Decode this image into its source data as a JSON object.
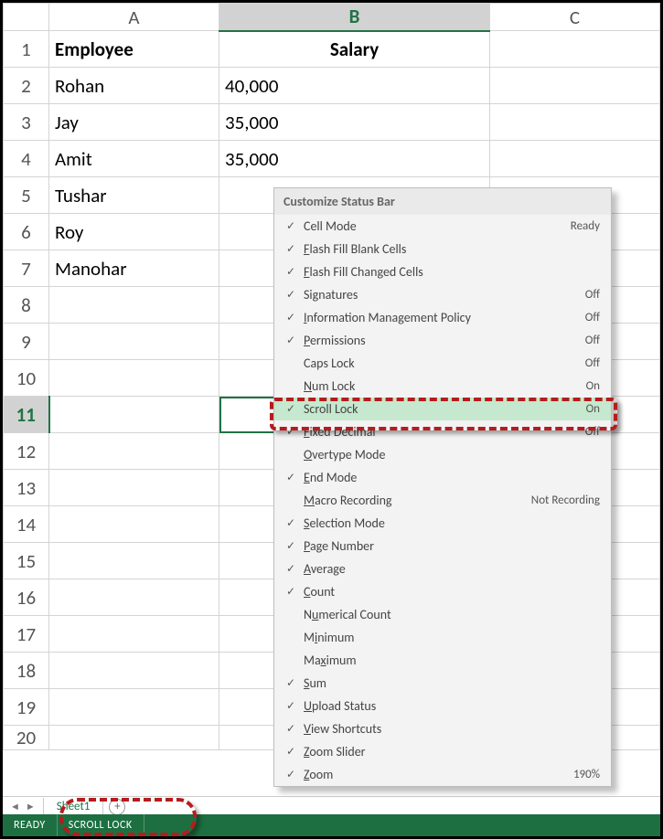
{
  "columns": [
    "A",
    "B",
    "C"
  ],
  "active_column": "B",
  "active_row": 11,
  "rows": [
    {
      "n": 1,
      "a": "Employee",
      "b": "Salary",
      "header": true
    },
    {
      "n": 2,
      "a": "Rohan",
      "b": "40,000"
    },
    {
      "n": 3,
      "a": "Jay",
      "b": "35,000"
    },
    {
      "n": 4,
      "a": "Amit",
      "b": "35,000"
    },
    {
      "n": 5,
      "a": "Tushar",
      "b": ""
    },
    {
      "n": 6,
      "a": "Roy",
      "b": ""
    },
    {
      "n": 7,
      "a": "Manohar",
      "b": ""
    },
    {
      "n": 8,
      "a": "",
      "b": ""
    },
    {
      "n": 9,
      "a": "",
      "b": ""
    },
    {
      "n": 10,
      "a": "",
      "b": ""
    },
    {
      "n": 11,
      "a": "",
      "b": "",
      "sel": true
    },
    {
      "n": 12,
      "a": "",
      "b": ""
    },
    {
      "n": 13,
      "a": "",
      "b": ""
    },
    {
      "n": 14,
      "a": "",
      "b": ""
    },
    {
      "n": 15,
      "a": "",
      "b": ""
    },
    {
      "n": 16,
      "a": "",
      "b": ""
    },
    {
      "n": 17,
      "a": "",
      "b": ""
    },
    {
      "n": 18,
      "a": "",
      "b": ""
    },
    {
      "n": 19,
      "a": "",
      "b": ""
    },
    {
      "n": 20,
      "a": "",
      "b": ""
    }
  ],
  "sheet_tab": "Sheet1",
  "newtab_glyph": "+",
  "status": {
    "ready": "READY",
    "scroll_lock": "SCROLL LOCK"
  },
  "menu": {
    "title": "Customize Status Bar",
    "items": [
      {
        "check": true,
        "label": "Cell Mode",
        "ul": "",
        "val": "Ready"
      },
      {
        "check": true,
        "label": "Flash Fill Blank Cells",
        "ul": "F"
      },
      {
        "check": true,
        "label": "Flash Fill Changed Cells",
        "ul": "F"
      },
      {
        "check": true,
        "label": "Signatures",
        "val": "Off"
      },
      {
        "check": true,
        "label": "Information Management Policy",
        "ul": "I",
        "val": "Off"
      },
      {
        "check": true,
        "label": "Permissions",
        "ul": "P",
        "val": "Off"
      },
      {
        "check": false,
        "label": "Caps Lock",
        "val": "Off"
      },
      {
        "check": false,
        "label": "Num Lock",
        "ul": "N",
        "val": "On"
      },
      {
        "check": true,
        "label": "Scroll Lock",
        "ul": "",
        "val": "On",
        "highlight": true
      },
      {
        "check": true,
        "label": "Fixed Decimal",
        "ul": "F",
        "val": "Off"
      },
      {
        "check": false,
        "label": "Overtype Mode",
        "ul": "O"
      },
      {
        "check": true,
        "label": "End Mode",
        "ul": "E"
      },
      {
        "check": false,
        "label": "Macro Recording",
        "ul": "M",
        "val": "Not Recording"
      },
      {
        "check": true,
        "label": "Selection Mode",
        "ul": "S"
      },
      {
        "check": true,
        "label": "Page Number",
        "ul": "P"
      },
      {
        "check": true,
        "label": "Average",
        "ul": "A"
      },
      {
        "check": true,
        "label": "Count",
        "ul": "C"
      },
      {
        "check": false,
        "label": "Numerical Count",
        "ul": "u"
      },
      {
        "check": false,
        "label": "Minimum",
        "ul": "i"
      },
      {
        "check": false,
        "label": "Maximum",
        "ul": "x"
      },
      {
        "check": true,
        "label": "Sum",
        "ul": "S"
      },
      {
        "check": true,
        "label": "Upload Status",
        "ul": "U"
      },
      {
        "check": true,
        "label": "View Shortcuts",
        "ul": "V"
      },
      {
        "check": true,
        "label": "Zoom Slider",
        "ul": "Z"
      },
      {
        "check": true,
        "label": "Zoom",
        "ul": "Z",
        "val": "190%"
      }
    ]
  }
}
